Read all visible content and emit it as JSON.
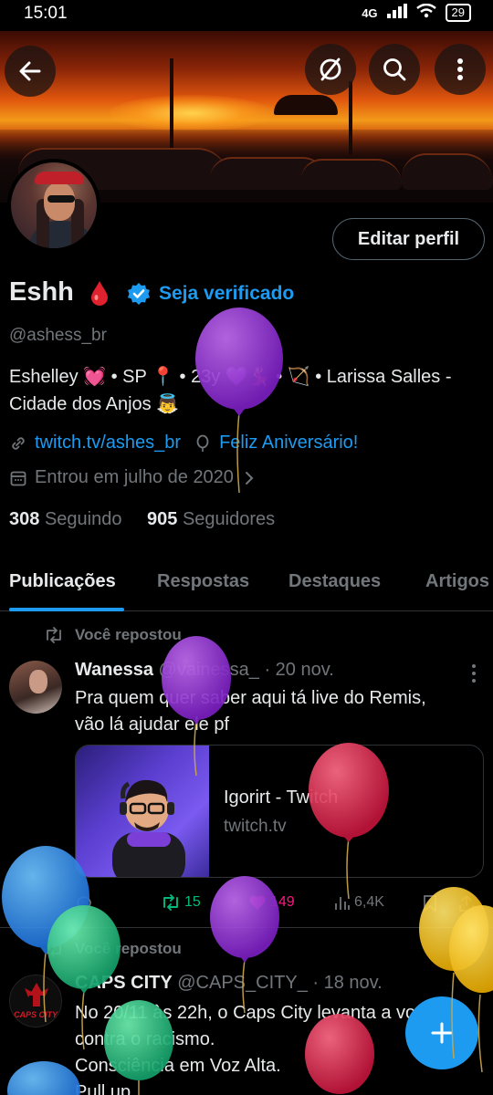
{
  "status_bar": {
    "time": "15:01",
    "network": "4G",
    "battery": "29"
  },
  "profile": {
    "name": "Eshh",
    "verify_link": "Seja verificado",
    "handle": "@ashess_br",
    "edit_button": "Editar perfil",
    "bio_line1": "Eshelley 💓 • SP 📍 • 23y 💜💃 • 🏹 • Larissa Salles -",
    "bio_line2": "Cidade dos Anjos 👼",
    "website": "twitch.tv/ashes_br",
    "birthday": "Feliz Aniversário!",
    "joined": "Entrou em julho de 2020",
    "following_count": "308",
    "following_label": "Seguindo",
    "followers_count": "905",
    "followers_label": "Seguidores"
  },
  "tabs": [
    {
      "label": "Publicações"
    },
    {
      "label": "Respostas"
    },
    {
      "label": "Destaques"
    },
    {
      "label": "Artigos"
    }
  ],
  "posts": [
    {
      "repost_label": "Você repostou",
      "author": "Wanessa",
      "handle": "@vainessa_",
      "date": "· 20 nov.",
      "text_line1": "Pra quem quer saber aqui tá live do Remis,",
      "text_line2": "vão lá ajudar ele pf",
      "card_title": "Igorirt - Twitch",
      "card_domain": "twitch.tv",
      "retweets": "15",
      "likes": "149",
      "views": "6,4K"
    },
    {
      "repost_label": "Você repostou",
      "author": "CAPS CITY",
      "handle": "@CAPS_CITY_",
      "date": "· 18 nov.",
      "avatar_text": "CAPS CITY",
      "text_line1": "No 20/11 às 22h, o Caps City levanta a voz",
      "text_line2": "contra o racismo.",
      "text_line3": "Consciência em Voz Alta.",
      "text_line4": "Pull up."
    }
  ],
  "colors": {
    "accent": "#1d9bf0",
    "background": "#000000",
    "text_primary": "#e7e9ea",
    "text_secondary": "#71767b",
    "retweet_green": "#00ba7c",
    "like_pink": "#f91880"
  },
  "icons": [
    "back-arrow-icon",
    "hide-icon",
    "search-icon",
    "more-vertical-icon",
    "verified-badge-icon",
    "link-icon",
    "balloon-icon",
    "calendar-icon",
    "chevron-right-icon",
    "repost-icon",
    "reply-icon",
    "like-icon",
    "views-icon",
    "bookmark-icon",
    "share-icon",
    "plus-icon"
  ]
}
